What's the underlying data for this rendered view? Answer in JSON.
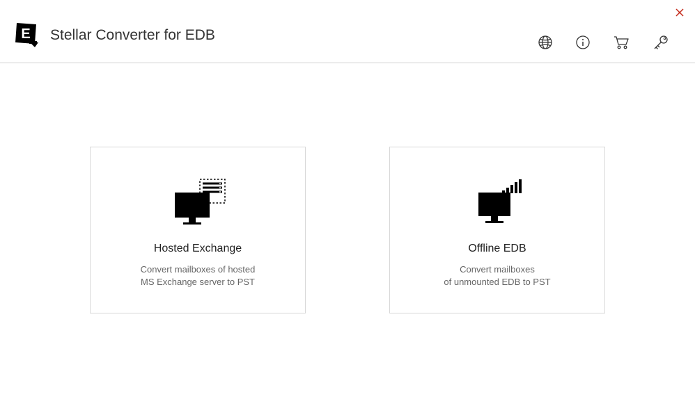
{
  "header": {
    "title": "Stellar Converter for EDB"
  },
  "cards": {
    "hosted": {
      "title": "Hosted Exchange",
      "description": "Convert mailboxes of hosted\nMS Exchange server to PST"
    },
    "offline": {
      "title": "Offline EDB",
      "description": "Convert mailboxes\nof unmounted EDB to PST"
    }
  }
}
